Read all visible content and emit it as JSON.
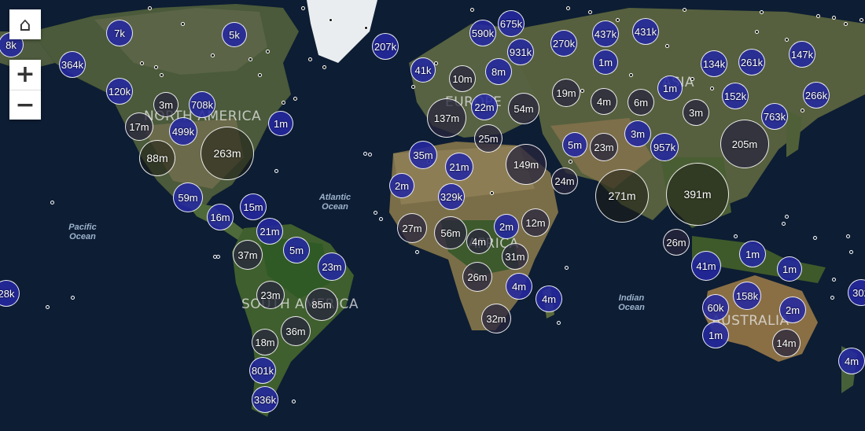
{
  "controls": {
    "home_icon": "⌂",
    "zoom_in": "+",
    "zoom_out": "−"
  },
  "labels": {
    "north_america": "NORTH AMERICA",
    "south_america": "SOUTH AMERICA",
    "europe": "EUROPE",
    "asia": "ASIA",
    "africa": "AFRICA",
    "australia": "AUSTRALIA"
  },
  "oceans": {
    "atlantic": "Atlantic Ocean",
    "pacific": "Pacific Ocean",
    "indian": "Indian Ocean"
  },
  "clusters": [
    "8k",
    "7k",
    "5k",
    "364k",
    "120k",
    "3m",
    "708k",
    "17m",
    "499k",
    "263m",
    "88m",
    "1m",
    "207k",
    "590k",
    "675k",
    "931k",
    "41k",
    "10m",
    "8m",
    "270k",
    "437k",
    "431k",
    "1m",
    "134k",
    "261k",
    "147k",
    "137m",
    "22m",
    "54m",
    "19m",
    "4m",
    "6m",
    "1m",
    "3m",
    "152k",
    "266k",
    "763k",
    "25m",
    "35m",
    "149m",
    "5m",
    "23m",
    "3m",
    "957k",
    "205m",
    "21m",
    "2m",
    "329k",
    "24m",
    "271m",
    "391m",
    "59m",
    "16m",
    "15m",
    "21m",
    "27m",
    "56m",
    "4m",
    "2m",
    "12m",
    "37m",
    "5m",
    "23m",
    "31m",
    "26m",
    "4m",
    "26m",
    "41m",
    "1m",
    "1m",
    "23m",
    "85m",
    "4m",
    "60k",
    "158k",
    "2m",
    "32m",
    "36m",
    "1m",
    "14m",
    "18m",
    "801k",
    "336k",
    "28k",
    "302",
    "4m"
  ]
}
